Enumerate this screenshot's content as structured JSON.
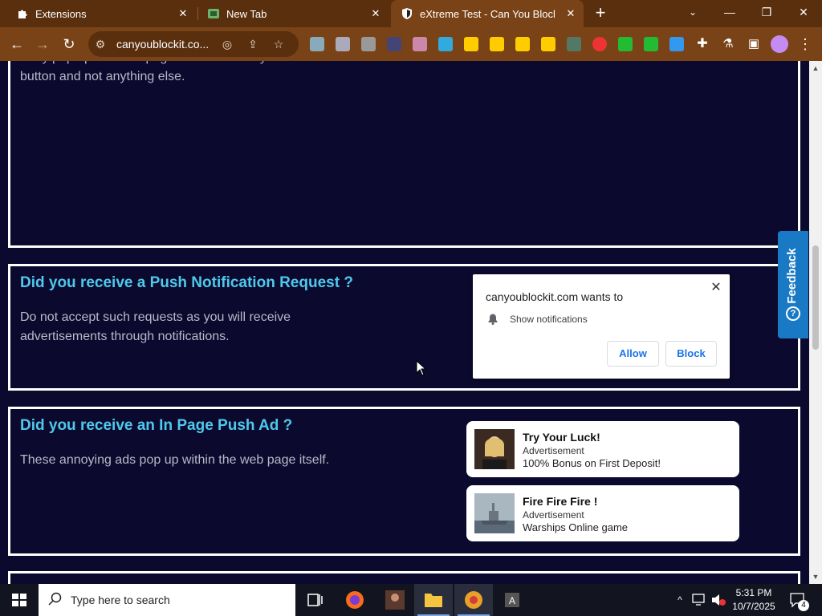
{
  "browser": {
    "tabs": [
      {
        "title": "Extensions",
        "icon": "puzzle-icon",
        "active": false
      },
      {
        "title": "New Tab",
        "icon": "newtab-icon",
        "active": false
      },
      {
        "title": "eXtreme Test - Can You Block It",
        "icon": "shield-icon",
        "active": true
      }
    ],
    "new_tab_label": "+",
    "url": "canyoublockit.co...",
    "window_controls": {
      "minimize": "—",
      "maximize": "❐",
      "close": "✕"
    }
  },
  "page": {
    "top_section": {
      "text": "They pop up before a page loads. Ensure you click the close button and not anything else."
    },
    "push_section": {
      "title": "Did you receive a Push Notification Request ?",
      "text": "Do not accept such requests as you will receive advertisements through notifications."
    },
    "inpage_section": {
      "title": "Did you receive an In Page Push Ad ?",
      "text": "These annoying ads pop up within the web page itself."
    },
    "feedback_label": "Feedback"
  },
  "notification_prompt": {
    "title": "canyoublockit.com wants to",
    "permission": "Show notifications",
    "allow_label": "Allow",
    "block_label": "Block"
  },
  "ads": [
    {
      "title": "Try Your Luck!",
      "label": "Advertisement",
      "description": "100% Bonus on First Deposit!"
    },
    {
      "title": "Fire Fire Fire !",
      "label": "Advertisement",
      "description": "Warships Online game"
    }
  ],
  "taskbar": {
    "search_placeholder": "Type here to search",
    "time": "5:31 PM",
    "date": "10/7/2025",
    "notification_count": "4"
  },
  "colors": {
    "chrome_frame": "#5a2f0e",
    "chrome_toolbar": "#7a4317",
    "page_bg": "#0b0a2e",
    "heading": "#4fc8ec",
    "feedback": "#1a79c4"
  }
}
